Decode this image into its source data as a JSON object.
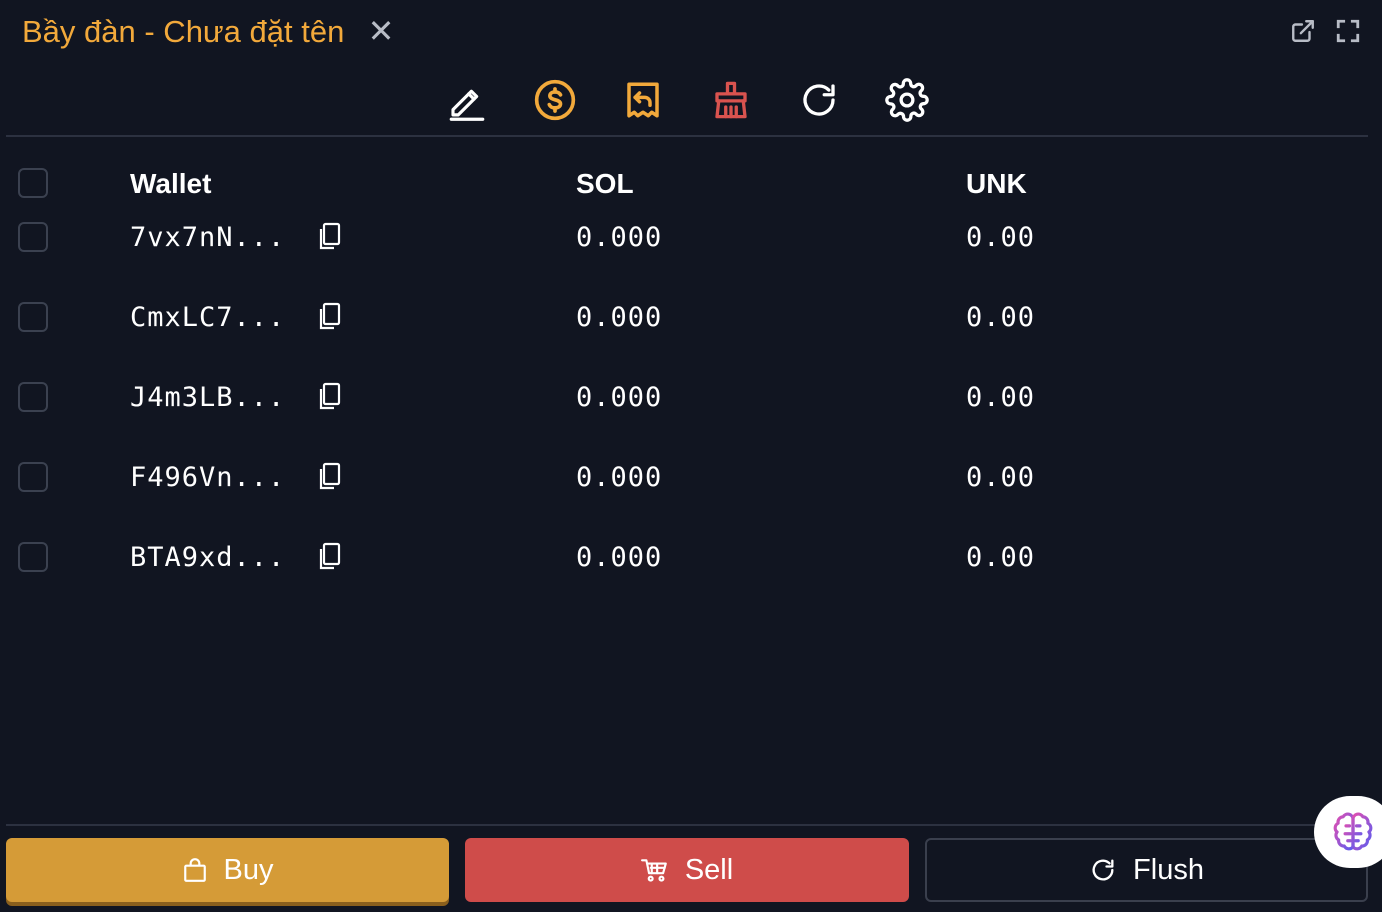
{
  "window": {
    "title": "Bầy đàn - Chưa đặt tên",
    "close_glyph": "✕",
    "popout_icon": "external-link-icon",
    "fullscreen_icon": "fullscreen-icon"
  },
  "toolbar": {
    "items": [
      {
        "name": "edit-icon",
        "color": "#ffffff"
      },
      {
        "name": "dollar-circle-icon",
        "color": "#f2a93b"
      },
      {
        "name": "receipt-return-icon",
        "color": "#f2a93b"
      },
      {
        "name": "broom-icon",
        "color": "#d9534f"
      },
      {
        "name": "refresh-icon",
        "color": "#ffffff"
      },
      {
        "name": "gear-icon",
        "color": "#ffffff"
      }
    ]
  },
  "table": {
    "headers": {
      "wallet": "Wallet",
      "sol": "SOL",
      "token": "UNK"
    },
    "rows": [
      {
        "wallet": "7vx7nN...",
        "sol": "0.000",
        "token": "0.00"
      },
      {
        "wallet": "CmxLC7...",
        "sol": "0.000",
        "token": "0.00"
      },
      {
        "wallet": "J4m3LB...",
        "sol": "0.000",
        "token": "0.00"
      },
      {
        "wallet": "F496Vn...",
        "sol": "0.000",
        "token": "0.00"
      },
      {
        "wallet": "BTA9xd...",
        "sol": "0.000",
        "token": "0.00"
      }
    ]
  },
  "actions": {
    "buy_label": "Buy",
    "sell_label": "Sell",
    "flush_label": "Flush"
  },
  "colors": {
    "accent": "#f2a93b",
    "buy": "#d59b37",
    "sell": "#cf4c4a",
    "background": "#111521"
  }
}
